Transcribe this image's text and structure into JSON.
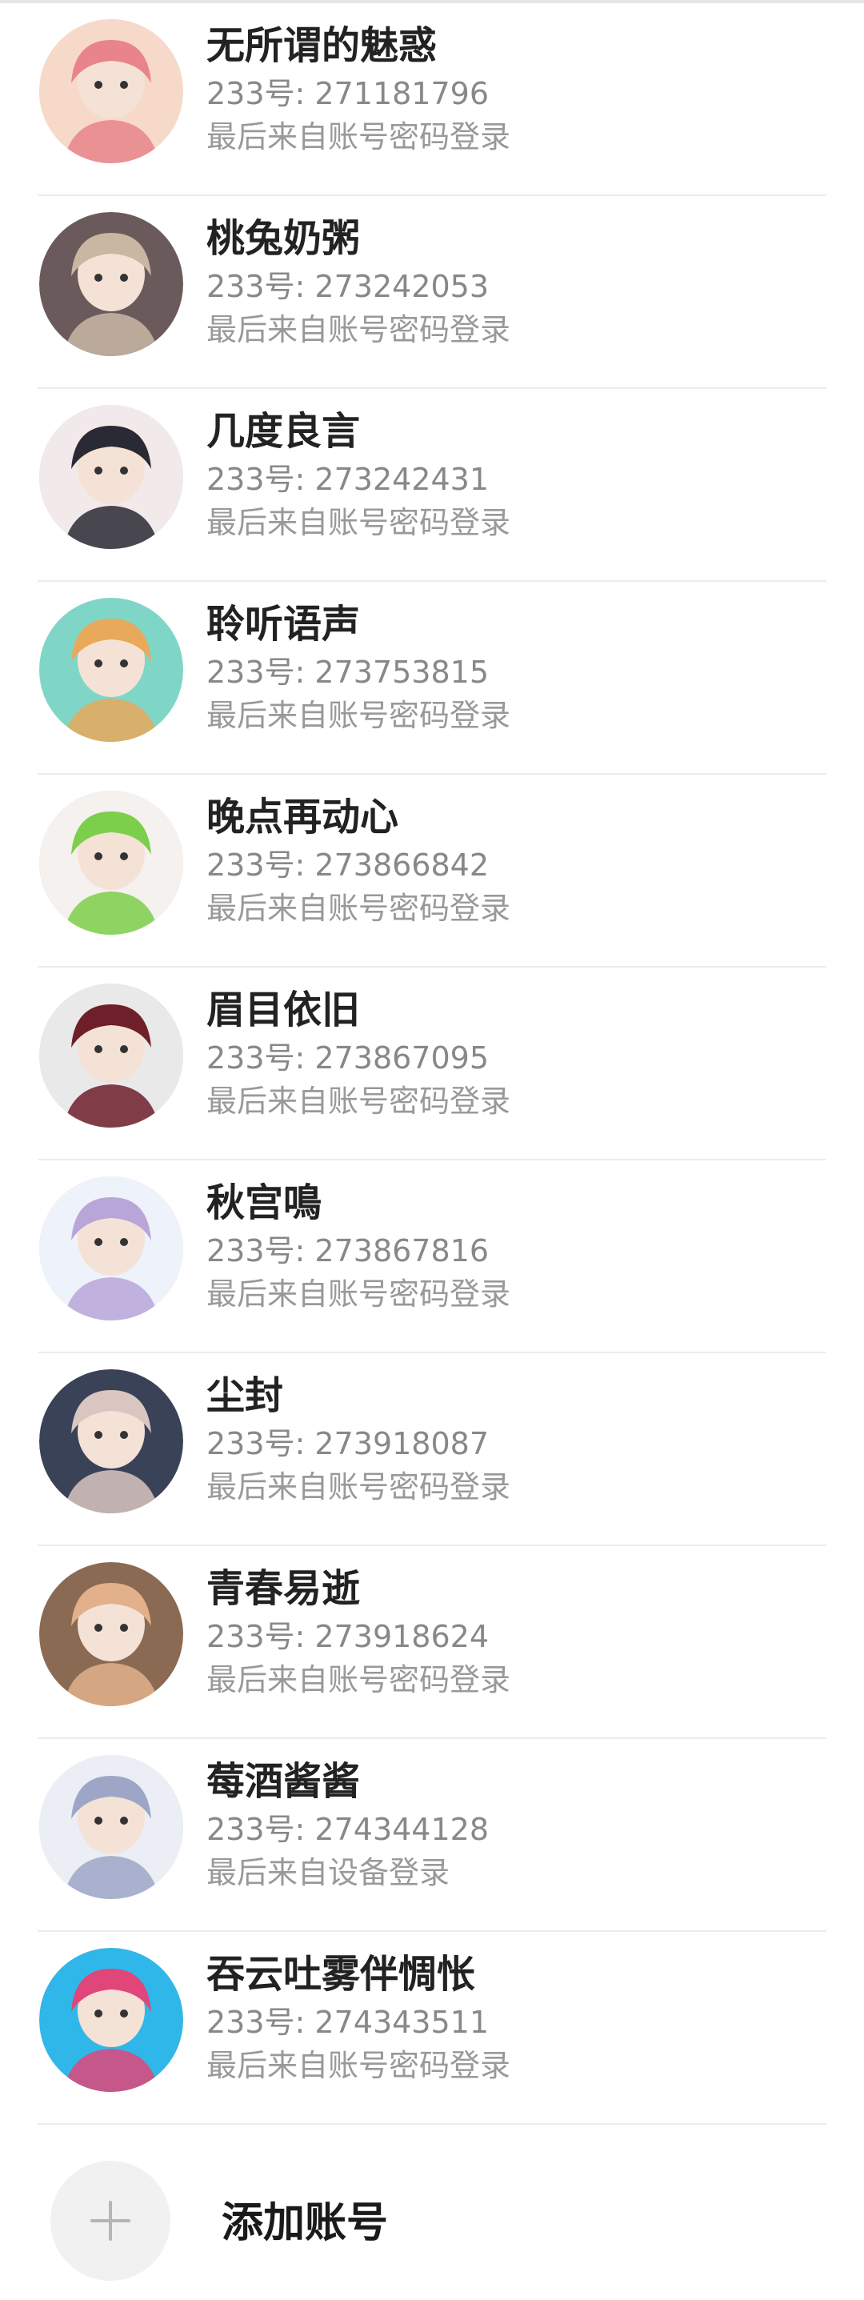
{
  "accounts": [
    {
      "name": "无所谓的魅惑",
      "uid_line": "233号: 271181796",
      "login": "最后来自账号密码登录",
      "bg": "#f6d9c8",
      "accent": "#e8848a"
    },
    {
      "name": "桃兔奶粥",
      "uid_line": "233号: 273242053",
      "login": "最后来自账号密码登录",
      "bg": "#6b5a5c",
      "accent": "#c9b7a3"
    },
    {
      "name": "几度良言",
      "uid_line": "233号: 273242431",
      "login": "最后来自账号密码登录",
      "bg": "#f2e9ea",
      "accent": "#2a2a35"
    },
    {
      "name": "聆听语声",
      "uid_line": "233号: 273753815",
      "login": "最后来自账号密码登录",
      "bg": "#7fd6c7",
      "accent": "#e9a95a"
    },
    {
      "name": "晚点再动心",
      "uid_line": "233号: 273866842",
      "login": "最后来自账号密码登录",
      "bg": "#f4f1ee",
      "accent": "#7ccf4a"
    },
    {
      "name": "眉目依旧",
      "uid_line": "233号: 273867095",
      "login": "最后来自账号密码登录",
      "bg": "#e9e9e9",
      "accent": "#6e1f2a"
    },
    {
      "name": "秋宫鳴",
      "uid_line": "233号: 273867816",
      "login": "最后来自账号密码登录",
      "bg": "#eef2fa",
      "accent": "#b9a6d9"
    },
    {
      "name": "尘封",
      "uid_line": "233号: 273918087",
      "login": "最后来自账号密码登录",
      "bg": "#3a4258",
      "accent": "#d9c6c1"
    },
    {
      "name": "青春易逝",
      "uid_line": "233号: 273918624",
      "login": "最后来自账号密码登录",
      "bg": "#8a6a52",
      "accent": "#e2b08b"
    },
    {
      "name": "莓酒酱酱",
      "uid_line": "233号: 274344128",
      "login": "最后来自设备登录",
      "bg": "#eceef6",
      "accent": "#9ea6c8"
    },
    {
      "name": "吞云吐雾伴惆怅",
      "uid_line": "233号: 274343511",
      "login": "最后来自账号密码登录",
      "bg": "#2fb7e9",
      "accent": "#e0467a"
    }
  ],
  "add_account": {
    "label": "添加账号",
    "icon": "plus-icon"
  },
  "colors": {
    "name_text": "#222222",
    "secondary_text": "#888888",
    "divider": "#ececec"
  }
}
